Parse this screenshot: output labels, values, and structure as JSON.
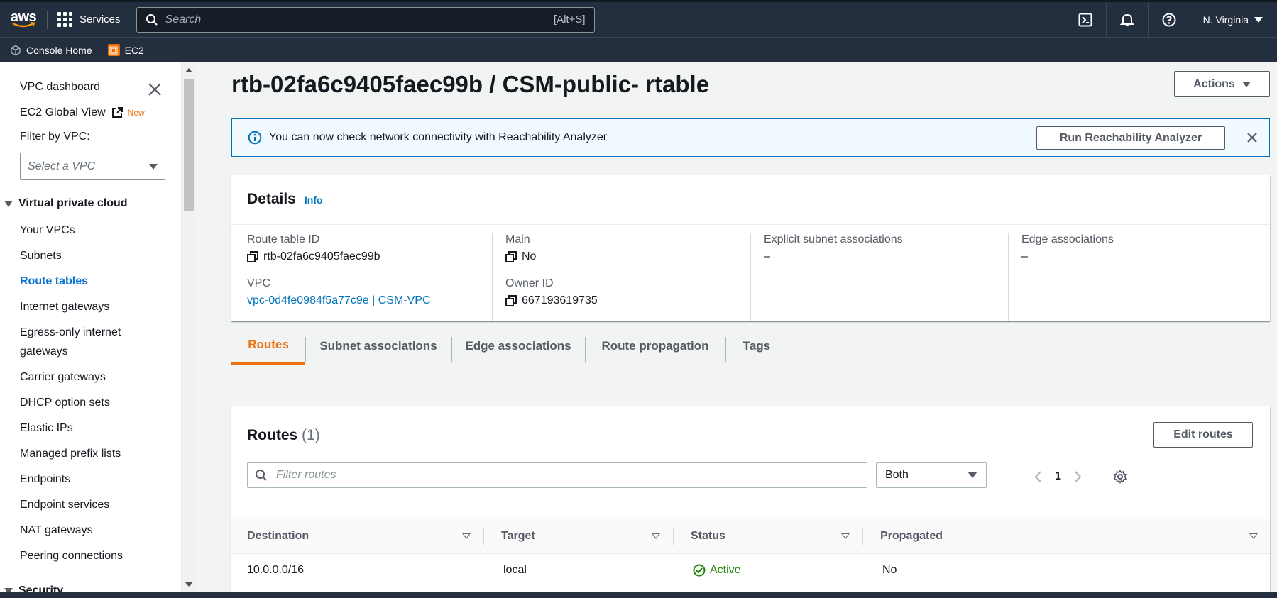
{
  "nav": {
    "logo": "aws",
    "services_label": "Services",
    "search_placeholder": "Search",
    "search_shortcut": "[Alt+S]",
    "region": "N. Virginia",
    "icons": [
      "cloudshell-icon",
      "bell-icon",
      "help-icon"
    ]
  },
  "favorites": [
    {
      "label": "Console Home",
      "icon": "cube-icon"
    },
    {
      "label": "EC2",
      "icon": "ec2-icon"
    }
  ],
  "sidebar": {
    "dashboard": "VPC dashboard",
    "global_view": "EC2 Global View",
    "new_badge": "New",
    "filter_label": "Filter by VPC:",
    "filter_placeholder": "Select a VPC",
    "section_title": "Virtual private cloud",
    "items": [
      {
        "label": "Your VPCs",
        "active": false
      },
      {
        "label": "Subnets",
        "active": false
      },
      {
        "label": "Route tables",
        "active": true
      },
      {
        "label": "Internet gateways",
        "active": false
      },
      {
        "label": "Egress-only internet",
        "active": false
      },
      {
        "label": "gateways",
        "active": false
      },
      {
        "label": "Carrier gateways",
        "active": false
      },
      {
        "label": "DHCP option sets",
        "active": false
      },
      {
        "label": "Elastic IPs",
        "active": false
      },
      {
        "label": "Managed prefix lists",
        "active": false
      },
      {
        "label": "Endpoints",
        "active": false
      },
      {
        "label": "Endpoint services",
        "active": false
      },
      {
        "label": "NAT gateways",
        "active": false
      },
      {
        "label": "Peering connections",
        "active": false
      }
    ],
    "next_section": "Security"
  },
  "page": {
    "title": "rtb-02fa6c9405faec99b / CSM-public- rtable",
    "actions_label": "Actions"
  },
  "banner": {
    "text": "You can now check network connectivity with Reachability Analyzer",
    "button": "Run Reachability Analyzer"
  },
  "details": {
    "heading": "Details",
    "info": "Info",
    "route_table_id_label": "Route table ID",
    "route_table_id": "rtb-02fa6c9405faec99b",
    "vpc_label": "VPC",
    "vpc_value": "vpc-0d4fe0984f5a77c9e | CSM-VPC",
    "main_label": "Main",
    "main_value": "No",
    "owner_label": "Owner ID",
    "owner_value": "667193619735",
    "explicit_label": "Explicit subnet associations",
    "explicit_value": "–",
    "edge_label": "Edge associations",
    "edge_value": "–"
  },
  "tabs": [
    "Routes",
    "Subnet associations",
    "Edge associations",
    "Route propagation",
    "Tags"
  ],
  "routes": {
    "title": "Routes",
    "count": "(1)",
    "edit_label": "Edit routes",
    "filter_placeholder": "Filter routes",
    "select_value": "Both",
    "page": "1",
    "columns": [
      "Destination",
      "Target",
      "Status",
      "Propagated"
    ],
    "rows": [
      {
        "destination": "10.0.0.0/16",
        "target": "local",
        "status": "Active",
        "propagated": "No"
      }
    ]
  },
  "colors": {
    "nav_bg": "#232f3e",
    "link": "#0073bb",
    "active_tab": "#ec7211",
    "success": "#1d8102"
  }
}
